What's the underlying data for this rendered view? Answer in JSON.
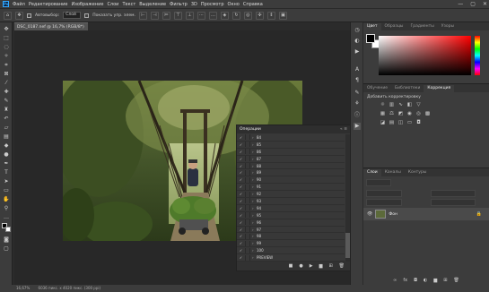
{
  "app": {
    "logo": "Ps"
  },
  "menu": [
    "Файл",
    "Редактирование",
    "Изображение",
    "Слои",
    "Текст",
    "Выделение",
    "Фильтр",
    "3D",
    "Просмотр",
    "Окно",
    "Справка"
  ],
  "window_controls": {
    "minimize": "—",
    "maximize": "▢",
    "close": "✕"
  },
  "options": {
    "autoselect_label": "Автовыбор:",
    "autoselect_value": "Слой",
    "show_controls_label": "Показать упр. элем."
  },
  "document": {
    "tab_title": "DSC_0187.nef @ 16,7% (RGB/8*)",
    "tab_close": "×"
  },
  "status": {
    "zoom": "16,67%",
    "info": "6036 пикс. x 4020 пикс. (300 ppi)"
  },
  "color_panel": {
    "tabs": [
      "Цвет",
      "Образцы",
      "Градиенты",
      "Узоры"
    ],
    "active": 0,
    "fg": "#000000",
    "bg": "#ffffff"
  },
  "adjust_panel": {
    "tabs": [
      "Обучение",
      "Библиотеки",
      "Коррекция"
    ],
    "active": 2,
    "title": "Добавить корректировку"
  },
  "layers_panel": {
    "tabs": [
      "Слои",
      "Каналы",
      "Контуры"
    ],
    "active": 0,
    "layer": {
      "name": "Фон",
      "lock_icon": "lock-icon"
    }
  },
  "actions_panel": {
    "title": "Операции",
    "controls": "« ≡",
    "rows": [
      "84",
      "85",
      "86",
      "87",
      "88",
      "89",
      "90",
      "91",
      "92",
      "93",
      "94",
      "95",
      "96",
      "97",
      "98",
      "99",
      "100",
      "PREVIEW",
      "PLAY ALL"
    ],
    "check": "✓"
  }
}
